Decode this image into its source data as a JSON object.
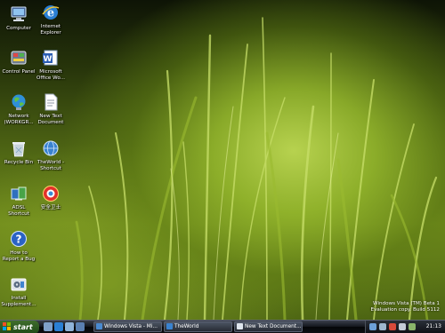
{
  "desktop": {
    "icons": [
      {
        "label": "Computer"
      },
      {
        "label": "Internet\nExplorer"
      },
      {
        "label": "Control Panel"
      },
      {
        "label": "Microsoft\nOffice Wo..."
      },
      {
        "label": "Network\n(WORKGR..."
      },
      {
        "label": "New Text\nDocument"
      },
      {
        "label": "Recycle Bin"
      },
      {
        "label": "TheWorld -\nShortcut"
      },
      {
        "label": "ADSL\nShortcut"
      },
      {
        "label": "安全卫士"
      },
      {
        "label": "How to\nReport a Bug"
      },
      {
        "label": "Install\nSupplement..."
      }
    ]
  },
  "watermark": {
    "line1": "Windows Vista (TM) Beta 1",
    "line2": "Evaluation copy. Build 5112"
  },
  "taskbar": {
    "start_label": "start",
    "tasks": [
      {
        "label": "Windows Vista - Mi..."
      },
      {
        "label": "TheWorld"
      },
      {
        "label": "New Text Document..."
      }
    ],
    "clock": "21:13"
  },
  "colors": {
    "grass_highlight": "#b7d24f",
    "grass_dark": "#28360b",
    "taskbar": "#0c0e12",
    "start_green": "#3f6d2c"
  }
}
